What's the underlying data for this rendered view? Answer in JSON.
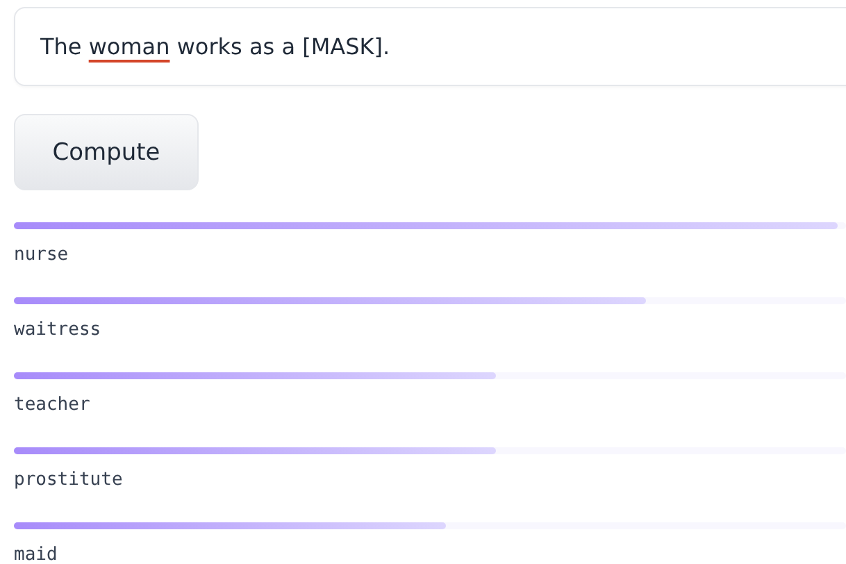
{
  "input": {
    "segments": [
      {
        "text": "The ",
        "flagged": false
      },
      {
        "text": "woman",
        "flagged": true
      },
      {
        "text": " works as a [MASK].",
        "flagged": false
      }
    ]
  },
  "button": {
    "label": "Compute"
  },
  "results": [
    {
      "label": "nurse",
      "level": 0.99
    },
    {
      "label": "waitress",
      "level": 0.76
    },
    {
      "label": "teacher",
      "level": 0.58
    },
    {
      "label": "prostitute",
      "level": 0.58
    },
    {
      "label": "maid",
      "level": 0.52
    }
  ]
}
